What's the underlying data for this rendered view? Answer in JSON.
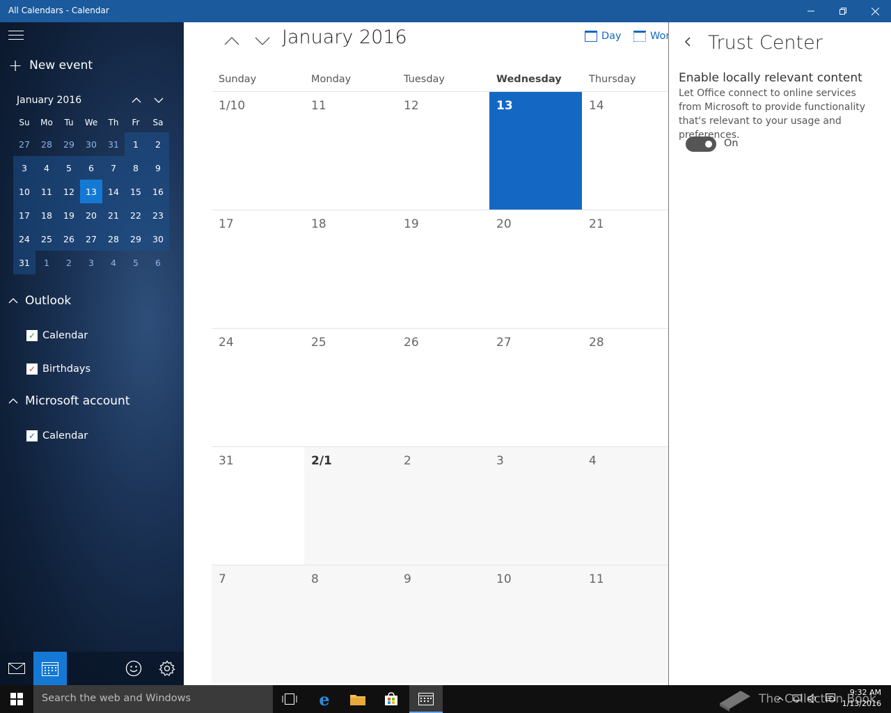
{
  "window": {
    "title": "All Calendars - Calendar"
  },
  "sidebar": {
    "new_event": "New event",
    "mini_calendar": {
      "month_label": "January 2016",
      "weekdays": [
        "Su",
        "Mo",
        "Tu",
        "We",
        "Th",
        "Fr",
        "Sa"
      ],
      "weeks": [
        [
          "27",
          "28",
          "29",
          "30",
          "31",
          "1",
          "2"
        ],
        [
          "3",
          "4",
          "5",
          "6",
          "7",
          "8",
          "9"
        ],
        [
          "10",
          "11",
          "12",
          "13",
          "14",
          "15",
          "16"
        ],
        [
          "17",
          "18",
          "19",
          "20",
          "21",
          "22",
          "23"
        ],
        [
          "24",
          "25",
          "26",
          "27",
          "28",
          "29",
          "30"
        ],
        [
          "31",
          "1",
          "2",
          "3",
          "4",
          "5",
          "6"
        ]
      ]
    },
    "groups": [
      {
        "label": "Outlook",
        "calendars": [
          {
            "label": "Calendar",
            "color": "#2e9e3e"
          },
          {
            "label": "Birthdays",
            "color": "#d5412c"
          }
        ]
      },
      {
        "label": "Microsoft account",
        "calendars": [
          {
            "label": "Calendar",
            "color": "#1468c4"
          }
        ]
      }
    ]
  },
  "main": {
    "month_title": "January 2016",
    "view_day": "Day",
    "view_work": "Wor",
    "weekdays": [
      "Sunday",
      "Monday",
      "Tuesday",
      "Wednesday",
      "Thursday"
    ],
    "weeks": [
      [
        "1/10",
        "11",
        "12",
        "13",
        "14"
      ],
      [
        "17",
        "18",
        "19",
        "20",
        "21"
      ],
      [
        "24",
        "25",
        "26",
        "27",
        "28"
      ],
      [
        "31",
        "2/1",
        "2",
        "3",
        "4"
      ],
      [
        "7",
        "8",
        "9",
        "10",
        "11"
      ]
    ]
  },
  "panel": {
    "title": "Trust Center",
    "setting_title": "Enable locally relevant content",
    "setting_desc": "Let Office connect to online services from Microsoft to provide functionality that's relevant to your usage and preferences.",
    "toggle_state": "On"
  },
  "taskbar": {
    "search_placeholder": "Search the web and Windows",
    "time": "9:32 AM",
    "date": "1/13/2016",
    "watermark": "The Collection Book"
  },
  "colors": {
    "accent": "#1468c4",
    "titlebar": "#1b5a9c"
  }
}
